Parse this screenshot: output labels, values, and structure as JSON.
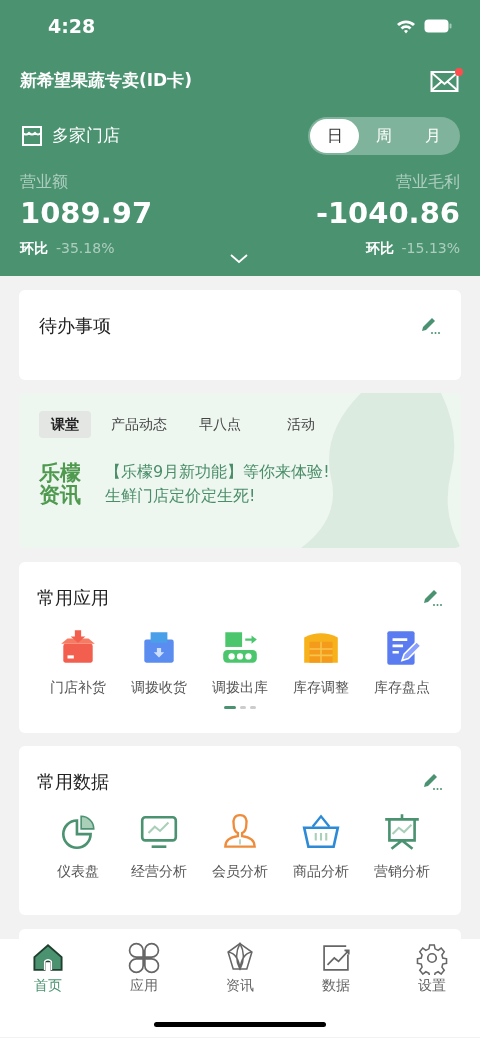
{
  "status_bar": {
    "time": "4:28"
  },
  "header": {
    "title": "新希望果蔬专卖(ID卡)",
    "notification": true,
    "store_label": "多家门店",
    "period_tabs": [
      {
        "label": "日",
        "selected": true
      },
      {
        "label": "周",
        "selected": false
      },
      {
        "label": "月",
        "selected": false
      }
    ],
    "metrics": [
      {
        "label": "营业额",
        "value": "1089.97",
        "compare_label": "环比",
        "compare_value": "-35.18%"
      },
      {
        "label": "营业毛利",
        "value": "-1040.86",
        "compare_label": "环比",
        "compare_value": "-15.13%"
      }
    ]
  },
  "todo": {
    "title": "待办事项"
  },
  "news": {
    "tabs": [
      {
        "label": "课堂",
        "selected": true
      },
      {
        "label": "产品动态",
        "selected": false
      },
      {
        "label": "早八点",
        "selected": false
      },
      {
        "label": "活动",
        "selected": false
      }
    ],
    "logo_lines": [
      "乐檬",
      "资讯"
    ],
    "headlines": [
      "【乐檬9月新功能】等你来体验!",
      "生鲜门店定价定生死!"
    ]
  },
  "apps": {
    "title": "常用应用",
    "items": [
      {
        "label": "门店补货",
        "kind": "restock"
      },
      {
        "label": "调拨收货",
        "kind": "receive"
      },
      {
        "label": "调拨出库",
        "kind": "ship"
      },
      {
        "label": "库存调整",
        "kind": "warehouse"
      },
      {
        "label": "库存盘点",
        "kind": "count"
      }
    ],
    "pages": [
      {
        "selected": true
      },
      {
        "selected": false
      },
      {
        "selected": false
      }
    ]
  },
  "data": {
    "title": "常用数据",
    "items": [
      {
        "label": "仪表盘",
        "kind": "pie"
      },
      {
        "label": "经营分析",
        "kind": "monitor"
      },
      {
        "label": "会员分析",
        "kind": "person"
      },
      {
        "label": "商品分析",
        "kind": "basket"
      },
      {
        "label": "营销分析",
        "kind": "board"
      }
    ]
  },
  "tab_bar": [
    {
      "label": "首页",
      "kind": "home",
      "selected": true
    },
    {
      "label": "应用",
      "kind": "apps",
      "selected": false
    },
    {
      "label": "资讯",
      "kind": "leaf",
      "selected": false
    },
    {
      "label": "数据",
      "kind": "chart",
      "selected": false
    },
    {
      "label": "设置",
      "kind": "gear",
      "selected": false
    }
  ]
}
